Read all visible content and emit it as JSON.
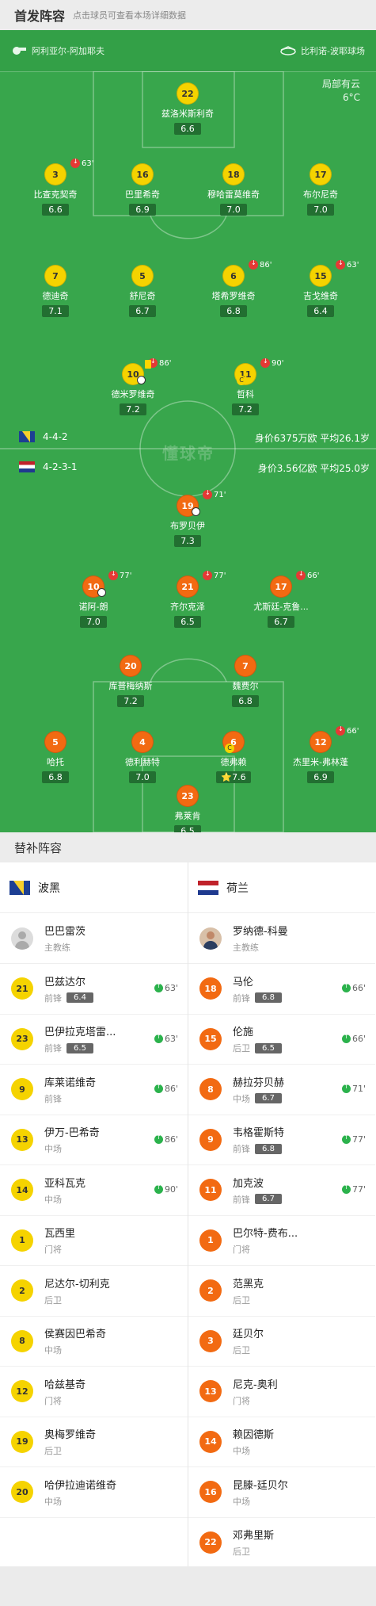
{
  "header": {
    "title": "首发阵容",
    "subtitle": "点击球员可查看本场详细数据"
  },
  "pitch": {
    "referee": "阿利亚尔-阿加耶夫",
    "stadium": "比利诺-波耶球场",
    "weather": "局部有云",
    "temperature": "6°C",
    "watermark": "懂球帝",
    "home_formation": "4-4-2",
    "home_value": "身价6375万欧  平均26.1岁",
    "away_formation": "4-2-3-1",
    "away_value": "身价3.56亿欧  平均25.0岁",
    "players": [
      {
        "side": "home",
        "num": "22",
        "name": "兹洛米斯利奇",
        "rating": "6.6"
      },
      {
        "side": "home",
        "num": "3",
        "name": "比查克契奇",
        "rating": "6.6",
        "sub": "63'"
      },
      {
        "side": "home",
        "num": "16",
        "name": "巴里希奇",
        "rating": "6.9"
      },
      {
        "side": "home",
        "num": "18",
        "name": "穆哈雷莫维奇",
        "rating": "7.0"
      },
      {
        "side": "home",
        "num": "17",
        "name": "布尔尼奇",
        "rating": "7.0"
      },
      {
        "side": "home",
        "num": "7",
        "name": "德迪奇",
        "rating": "7.1"
      },
      {
        "side": "home",
        "num": "5",
        "name": "舒尼奇",
        "rating": "6.7"
      },
      {
        "side": "home",
        "num": "6",
        "name": "塔希罗维奇",
        "rating": "6.8",
        "sub": "86'"
      },
      {
        "side": "home",
        "num": "15",
        "name": "吉戈维奇",
        "rating": "6.4",
        "sub": "63'"
      },
      {
        "side": "home",
        "num": "10",
        "name": "德米罗维奇",
        "rating": "7.2",
        "sub": "86'"
      },
      {
        "side": "home",
        "num": "11",
        "name": "哲科",
        "rating": "7.2",
        "sub": "90'"
      },
      {
        "side": "away",
        "num": "19",
        "name": "布罗贝伊",
        "rating": "7.3",
        "sub": "71'"
      },
      {
        "side": "away",
        "num": "10",
        "name": "诺阿-朗",
        "rating": "7.0",
        "sub": "77'"
      },
      {
        "side": "away",
        "num": "21",
        "name": "齐尔克泽",
        "rating": "6.5",
        "sub": "77'"
      },
      {
        "side": "away",
        "num": "17",
        "name": "尤斯廷-克鲁...",
        "rating": "6.7",
        "sub": "66'"
      },
      {
        "side": "away",
        "num": "20",
        "name": "库普梅纳斯",
        "rating": "7.2"
      },
      {
        "side": "away",
        "num": "7",
        "name": "魏费尔",
        "rating": "6.8"
      },
      {
        "side": "away",
        "num": "5",
        "name": "哈托",
        "rating": "6.8"
      },
      {
        "side": "away",
        "num": "4",
        "name": "德利赫特",
        "rating": "7.0"
      },
      {
        "side": "away",
        "num": "6",
        "name": "德弗赖",
        "rating": "⭐7.6"
      },
      {
        "side": "away",
        "num": "12",
        "name": "杰里米-弗林蓬",
        "rating": "6.9",
        "sub": "66'"
      },
      {
        "side": "away",
        "num": "23",
        "name": "弗莱肯",
        "rating": "6.5"
      }
    ]
  },
  "subs": {
    "title": "替补阵容",
    "home": {
      "team": "波黑",
      "coach": {
        "name": "巴巴雷茨",
        "role": "主教练"
      },
      "players": [
        {
          "num": "21",
          "name": "巴兹达尔",
          "pos": "前锋",
          "rating": "6.4",
          "min": "63'"
        },
        {
          "num": "23",
          "name": "巴伊拉克塔雷...",
          "pos": "前锋",
          "rating": "6.5",
          "min": "63'"
        },
        {
          "num": "9",
          "name": "库莱诺维奇",
          "pos": "前锋",
          "rating": "",
          "min": "86'"
        },
        {
          "num": "13",
          "name": "伊万-巴希奇",
          "pos": "中场",
          "rating": "",
          "min": "86'"
        },
        {
          "num": "14",
          "name": "亚科瓦克",
          "pos": "中场",
          "rating": "",
          "min": "90'"
        },
        {
          "num": "1",
          "name": "瓦西里",
          "pos": "门将",
          "rating": "",
          "min": ""
        },
        {
          "num": "2",
          "name": "尼达尔-切利克",
          "pos": "后卫",
          "rating": "",
          "min": ""
        },
        {
          "num": "8",
          "name": "侯赛因巴希奇",
          "pos": "中场",
          "rating": "",
          "min": ""
        },
        {
          "num": "12",
          "name": "哈兹基奇",
          "pos": "门将",
          "rating": "",
          "min": ""
        },
        {
          "num": "19",
          "name": "奥梅罗维奇",
          "pos": "后卫",
          "rating": "",
          "min": ""
        },
        {
          "num": "20",
          "name": "哈伊拉迪诺维奇",
          "pos": "中场",
          "rating": "",
          "min": ""
        }
      ]
    },
    "away": {
      "team": "荷兰",
      "coach": {
        "name": "罗纳德-科曼",
        "role": "主教练"
      },
      "players": [
        {
          "num": "18",
          "name": "马伦",
          "pos": "前锋",
          "rating": "6.8",
          "min": "66'"
        },
        {
          "num": "15",
          "name": "伦施",
          "pos": "后卫",
          "rating": "6.5",
          "min": "66'"
        },
        {
          "num": "8",
          "name": "赫拉芬贝赫",
          "pos": "中场",
          "rating": "6.7",
          "min": "71'"
        },
        {
          "num": "9",
          "name": "韦格霍斯特",
          "pos": "前锋",
          "rating": "6.8",
          "min": "77'"
        },
        {
          "num": "11",
          "name": "加克波",
          "pos": "前锋",
          "rating": "6.7",
          "min": "77'"
        },
        {
          "num": "1",
          "name": "巴尔特-费布...",
          "pos": "门将",
          "rating": "",
          "min": ""
        },
        {
          "num": "2",
          "name": "范黑克",
          "pos": "后卫",
          "rating": "",
          "min": ""
        },
        {
          "num": "3",
          "name": "廷贝尔",
          "pos": "后卫",
          "rating": "",
          "min": ""
        },
        {
          "num": "13",
          "name": "尼克-奥利",
          "pos": "门将",
          "rating": "",
          "min": ""
        },
        {
          "num": "14",
          "name": "赖因德斯",
          "pos": "中场",
          "rating": "",
          "min": ""
        },
        {
          "num": "16",
          "name": "昆滕-廷贝尔",
          "pos": "中场",
          "rating": "",
          "min": ""
        },
        {
          "num": "22",
          "name": "邓弗里斯",
          "pos": "后卫",
          "rating": "",
          "min": ""
        }
      ]
    }
  }
}
